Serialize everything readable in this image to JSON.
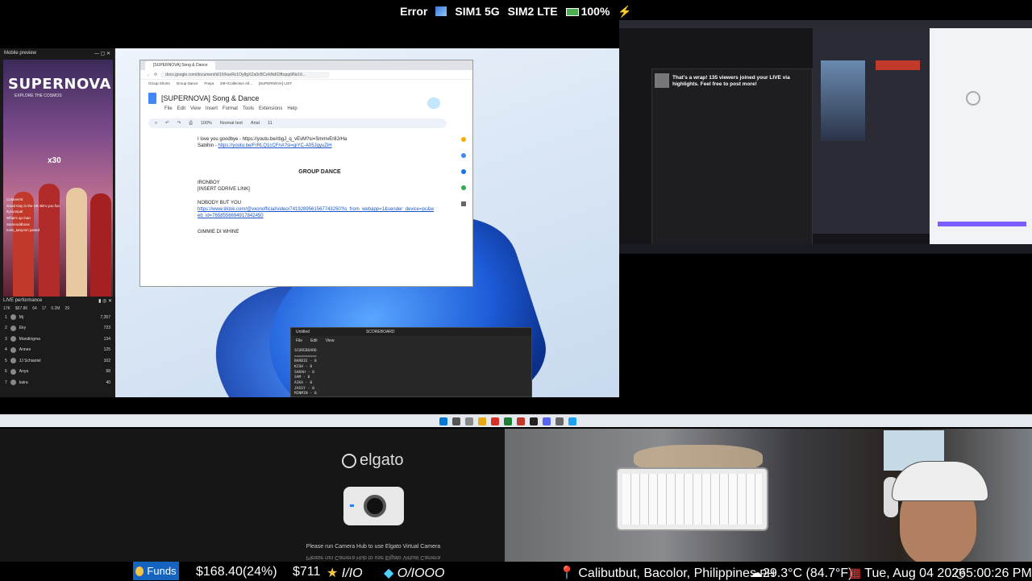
{
  "status_bar": {
    "error": "Error",
    "sim1": "SIM1 5G",
    "sim2": "SIM2 LTE",
    "battery": "100%"
  },
  "mobile_preview": {
    "title": "Mobile preview",
    "brand": "SUPERNOVA",
    "tagline": "EXPLORE THE COSMOS",
    "gift_count": "x30",
    "chat": [
      "Coldverrst",
      "Good Day in the UK Blim you fun",
      "Ilysoonpal",
      "What's up man",
      "Sameoddboss",
      "Iceis_tanyonn joined"
    ]
  },
  "live_performance": {
    "title": "LIVE performance",
    "stats": [
      "17K",
      "$67.86",
      "64",
      "17",
      "0.2M",
      "29"
    ],
    "rows": [
      {
        "rank": "1",
        "name": "Mj",
        "value": "7,357"
      },
      {
        "rank": "2",
        "name": "Eky",
        "value": "723"
      },
      {
        "rank": "3",
        "name": "Mandirigma",
        "value": "134"
      },
      {
        "rank": "4",
        "name": "Annee",
        "value": "125"
      },
      {
        "rank": "5",
        "name": "JJ Schianlel",
        "value": "102"
      },
      {
        "rank": "6",
        "name": "Anya",
        "value": "68"
      },
      {
        "rank": "7",
        "name": "kaira",
        "value": "40"
      }
    ]
  },
  "gdoc": {
    "tab_title": "[SUPERNOVA] Song & Dance",
    "url": "docs.google.com/document/d/1tVkseRc1Oy8gXZa0cBCz/kNd02fbqop9Nx1/t...",
    "bookmarks": [
      "Group Shorts",
      "Group Dance",
      "Fraya",
      "3!9+/Collection All...",
      "[SUPERNOVA] LIST"
    ],
    "doc_title": "[SUPERNOVA] Song & Dance",
    "menu": [
      "File",
      "Edit",
      "View",
      "Insert",
      "Format",
      "Tools",
      "Extensions",
      "Help"
    ],
    "toolbar": {
      "zoom": "100%",
      "style": "Normal text",
      "font": "Arial",
      "size": "11"
    },
    "line_top": "I love you goodbye - https://youtu.be/rbgJ_q_vEvM?si=SmmvEr8JrHa",
    "sabihin_label": "Sabihin - ",
    "sabihin_link": "https://youtu.be/FrRLQ1cCFnA?si=giYC-A05JgyuZiH",
    "section": "GROUP DANCE",
    "song1": "IRONBOY",
    "song1_note": "[INSERT GDRIVE LINK]",
    "song2": "NOBODY BUT YOU",
    "song2_link": "https://www.tiktok.com/@vxonofficial/video/7419289561567743250?is_from_webapp=1&sender_device=pc&web_id=7658556694917842450",
    "song3": "GIMMIE DI WHINE"
  },
  "notepad": {
    "tab": "Untitled",
    "tab2": "SCOREBOARD",
    "menu": [
      "File",
      "Edit",
      "View"
    ],
    "lines": [
      "SCOREBOARD",
      "==========",
      "BARBIE - 0",
      "KISH - 0",
      "SARAH - 0",
      "SAM - 0",
      "AIKA - 0",
      "JASSY - 0",
      "MINMIN - 0"
    ]
  },
  "streamer_panel": {
    "message": "That's a wrap! 135 viewers joined your LIVE via highlights. Feel free to post more!"
  },
  "elgato": {
    "brand": "elgato",
    "notice": "Please run Camera Hub to use Elgato Virtual Camera",
    "notice_mirror": "Please run Camera Hub to use Elgato Virtual Camera"
  },
  "ticker": {
    "funds_label": "Funds",
    "funds_value": "$168.40(24%)",
    "cash": "$711",
    "stars": "I/IO",
    "gems": "O/IOOO",
    "location": "Calibutbut, Bacolor, Philippines",
    "country": "PH",
    "weather": "29.3°C (84.7°F)",
    "date": "Tue, Aug 04 2026",
    "time": "5:00:26 PM"
  },
  "colors": {
    "funds_bg": "#1565c0",
    "accent_blue": "#1a55c9",
    "battery_green": "#4caf50"
  }
}
